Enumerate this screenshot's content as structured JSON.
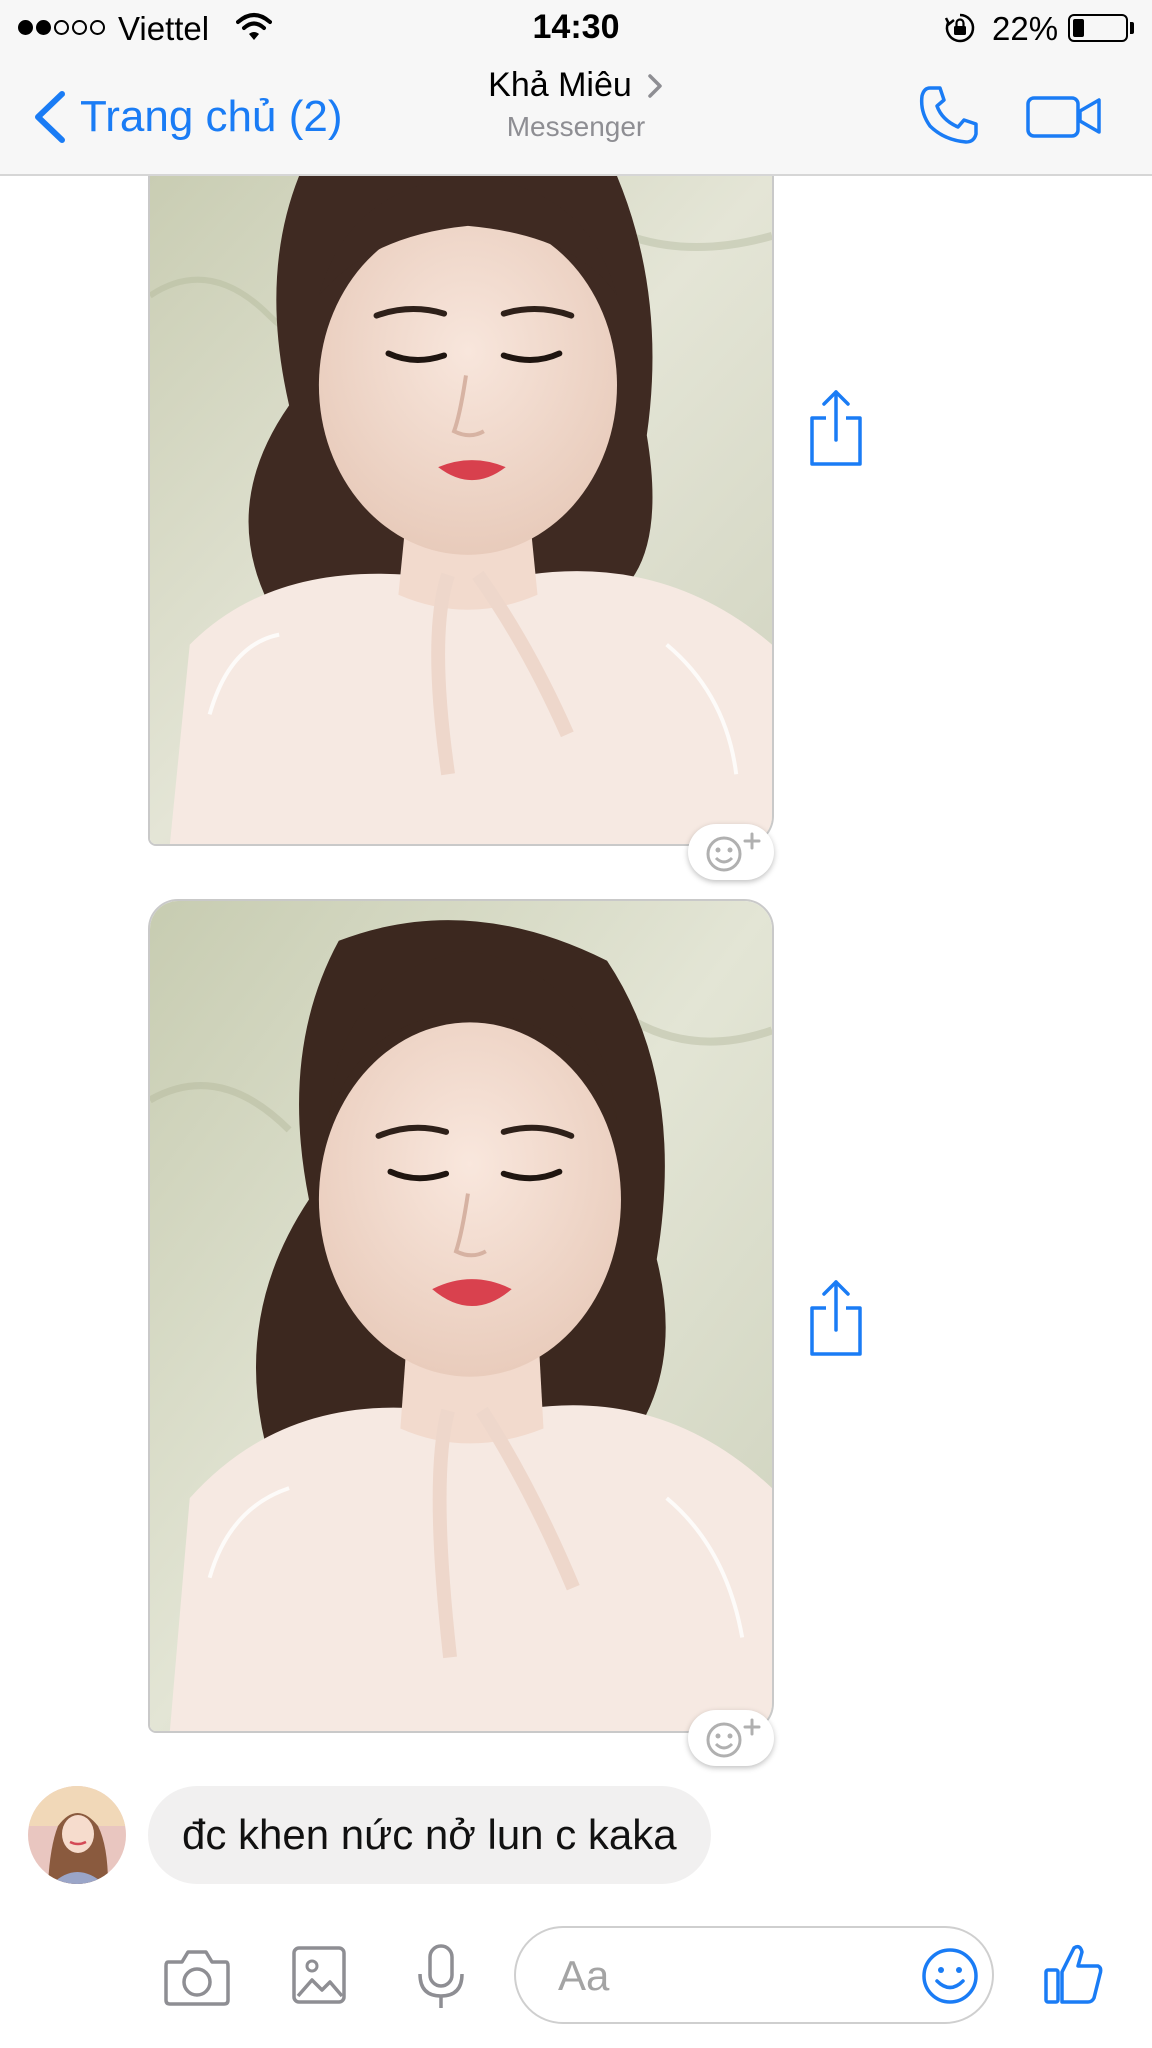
{
  "status_bar": {
    "carrier": "Viettel",
    "signal_bars_filled": 2,
    "signal_bars_total": 5,
    "time": "14:30",
    "battery_percent": "22%",
    "battery_level": 0.22
  },
  "nav": {
    "back_label": "Trang chủ (2)",
    "contact_name": "Khả Miêu",
    "subtitle": "Messenger"
  },
  "chat": {
    "messages": [
      {
        "type": "image",
        "description_icon": "photo"
      },
      {
        "type": "image",
        "description_icon": "photo"
      },
      {
        "type": "text",
        "text": "đc khen nức nở lun c kaka"
      }
    ]
  },
  "composer": {
    "placeholder": "Aa"
  },
  "colors": {
    "accent": "#1a7cf5",
    "bubble_bg": "#f1f0f0",
    "bar_bg": "#f7f7f7"
  }
}
